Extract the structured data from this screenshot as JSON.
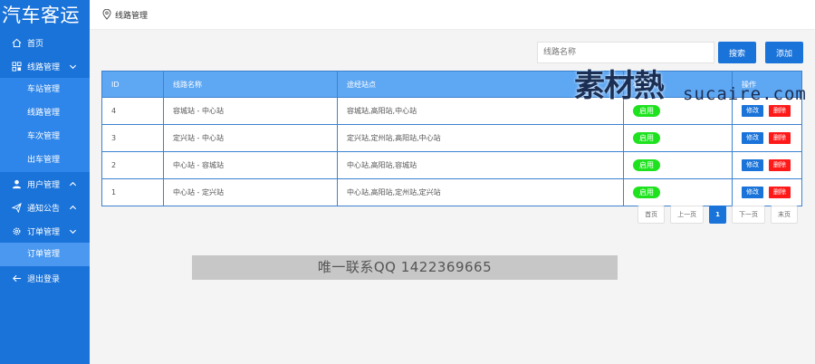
{
  "app": {
    "brand": "汽车客运"
  },
  "sidebar": {
    "home": "首页",
    "route_mgmt": "线路管理",
    "sub_routes": [
      "车站管理",
      "线路管理",
      "车次管理",
      "出车管理"
    ],
    "user_mgmt": "用户管理",
    "notice": "通知公告",
    "order_mgmt": "订单管理",
    "sub_orders": [
      "订单管理"
    ],
    "logout": "退出登录"
  },
  "header": {
    "breadcrumb": "线路管理"
  },
  "search": {
    "placeholder": "线路名称",
    "value": "",
    "search_label": "搜索",
    "add_label": "添加"
  },
  "table": {
    "headers": [
      "ID",
      "线路名称",
      "途经站点",
      "状态",
      "操作"
    ],
    "rows": [
      {
        "id": "4",
        "name": "容城站 - 中心站",
        "stations": "容城站,高阳站,中心站",
        "status": "启用"
      },
      {
        "id": "3",
        "name": "定兴站 - 中心站",
        "stations": "定兴站,定州站,高阳站,中心站",
        "status": "启用"
      },
      {
        "id": "2",
        "name": "中心站 - 容城站",
        "stations": "中心站,高阳站,容城站",
        "status": "启用"
      },
      {
        "id": "1",
        "name": "中心站 - 定兴站",
        "stations": "中心站,高阳站,定州站,定兴站",
        "status": "启用"
      }
    ],
    "edit_label": "修改",
    "delete_label": "删除"
  },
  "pagination": {
    "first": "首页",
    "prev": "上一页",
    "current": "1",
    "next": "下一页",
    "last": "末页"
  },
  "overlay": {
    "contact": "唯一联系QQ 1422369665",
    "watermark_cn": "素材熱",
    "watermark_en": "sucaire.com"
  },
  "colors": {
    "primary": "#1a73d9",
    "enabled": "#1fe21f",
    "danger": "#ff1a1a",
    "table_header": "#5ea7f3"
  }
}
